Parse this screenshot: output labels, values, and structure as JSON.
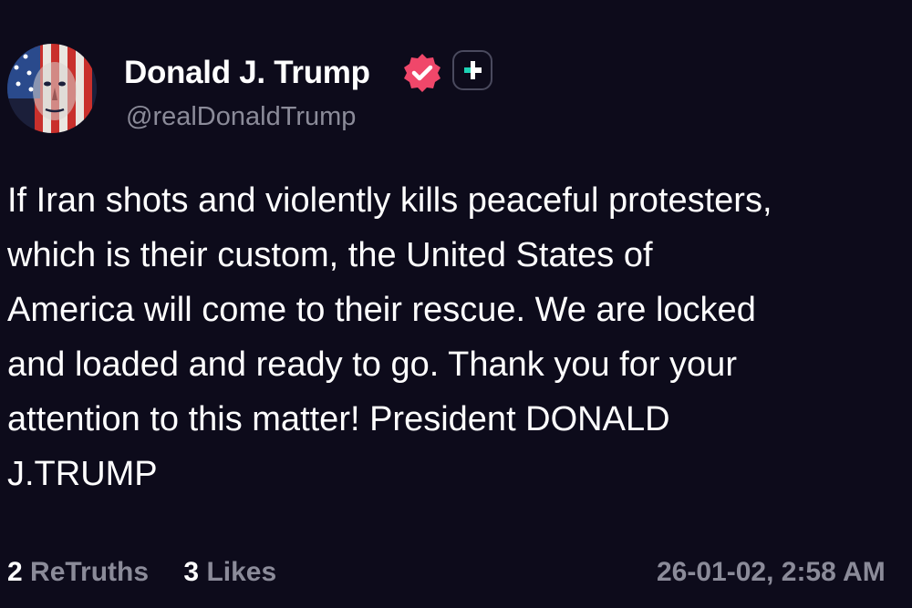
{
  "post": {
    "author": {
      "display_name": "Donald J. Trump",
      "handle": "@realDonaldTrump",
      "verified": true,
      "avatar_icon": "flag-portrait-avatar",
      "verified_icon": "verified-badge-icon",
      "plus_icon": "plus-badge-icon"
    },
    "text_lines": [
      "If Iran shots and violently kills peaceful protesters,",
      "which is their custom, the United States of",
      "America will come to their rescue. We are locked",
      "and loaded and ready to go. Thank you for your",
      "attention to this matter! President DONALD",
      "J.TRUMP"
    ],
    "stats": {
      "retruths_count": "2",
      "retruths_label": "ReTruths",
      "likes_count": "3",
      "likes_label": "Likes"
    },
    "timestamp": "26-01-02, 2:58 AM"
  },
  "colors": {
    "background": "#0d0b1b",
    "text_primary": "#ffffff",
    "text_secondary": "#8b8b99",
    "verified_badge": "#f0476a",
    "plus_accent": "#1ed3b5"
  }
}
